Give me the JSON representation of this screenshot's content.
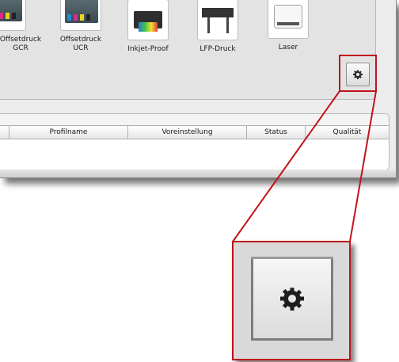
{
  "devices": [
    {
      "label_line1": "Offsetdruck",
      "label_line2": "GCR",
      "icon": "offset-press-icon"
    },
    {
      "label_line1": "Offsetdruck",
      "label_line2": "UCR",
      "icon": "offset-press-icon"
    },
    {
      "label_line1": "Inkjet-Proof",
      "label_line2": "",
      "icon": "inkjet-printer-icon"
    },
    {
      "label_line1": "LFP-Druck",
      "label_line2": "",
      "icon": "large-format-printer-icon"
    },
    {
      "label_line1": "Laser",
      "label_line2": "",
      "icon": "laser-printer-icon"
    }
  ],
  "settings_button": {
    "icon": "gear-icon"
  },
  "table": {
    "columns": [
      "",
      "Profilname",
      "Voreinstellung",
      "Status",
      "Qualität"
    ]
  },
  "colors": {
    "callout": "#c1121c"
  }
}
